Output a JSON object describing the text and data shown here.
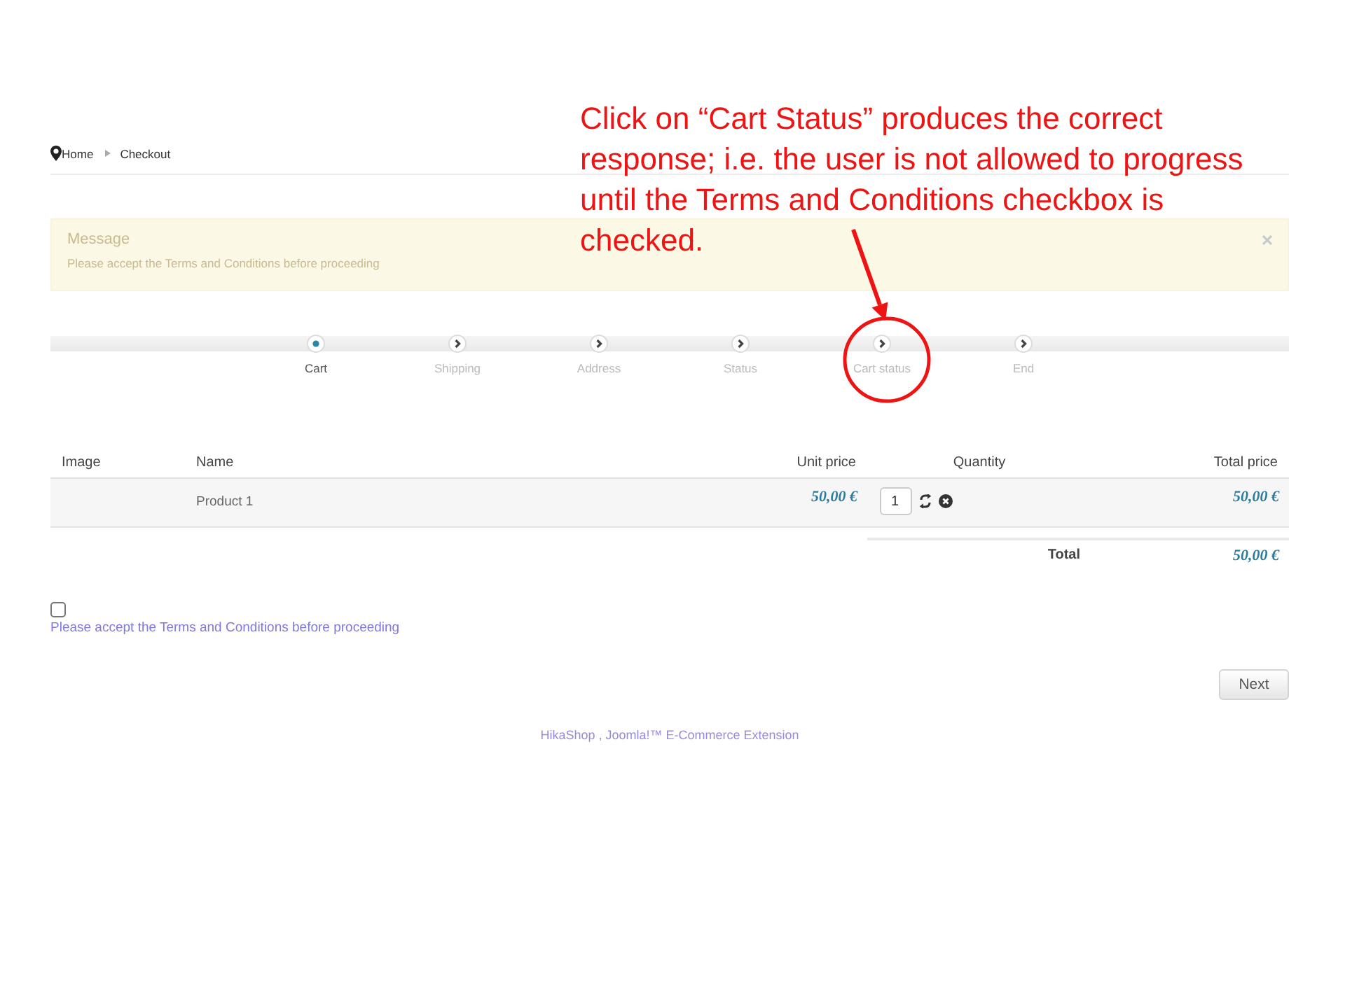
{
  "breadcrumb": [
    {
      "label": "Home",
      "kind": "home"
    },
    {
      "label": "Checkout",
      "kind": "page"
    }
  ],
  "message": {
    "title": "Message",
    "text": "Please accept the Terms and Conditions before proceeding"
  },
  "steps": [
    {
      "label": "Cart",
      "selected": true
    },
    {
      "label": "Shipping",
      "selected": false
    },
    {
      "label": "Address",
      "selected": false
    },
    {
      "label": "Status",
      "selected": false
    },
    {
      "label": "Cart status",
      "selected": false
    },
    {
      "label": "End",
      "selected": false
    }
  ],
  "cart": {
    "columns": [
      "Image",
      "Name",
      "Unit price",
      "Quantity",
      "Total price"
    ],
    "rows": [
      {
        "name": "Product 1",
        "unit_price": "50,00 €",
        "quantity": "1",
        "total_price": "50,00 €"
      }
    ],
    "total_label": "Total",
    "total": "50,00 €"
  },
  "terms": {
    "checked": false,
    "text": "Please accept the Terms and Conditions before proceeding"
  },
  "buttons": [
    {
      "label": "Next"
    }
  ],
  "footer": "HikaShop , Joomla!™ E-Commerce Extension",
  "annotation": {
    "text": "Click on “Cart Status” produces the correct response; i.e. the user is not allowed to progress until the Terms and Conditions checkbox is checked."
  }
}
